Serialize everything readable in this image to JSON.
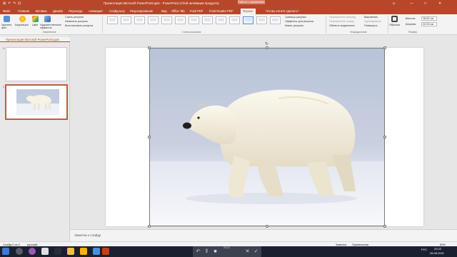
{
  "titlebar": {
    "quick_access": [
      "⊞",
      "↶",
      "↷",
      "⊡"
    ],
    "title": "Презентация Microsoft PowerPoint.pptx - PowerPoint (Сбой активации продукта)",
    "context_group": "Работа с рисунками",
    "user_icon": "user-icon",
    "controls": [
      "—",
      "□",
      "✕"
    ]
  },
  "tabs": [
    "Файл",
    "Главная",
    "Вставка",
    "Дизайн",
    "Переходы",
    "Анимация",
    "Слайд-шоу",
    "Рецензирование",
    "Вид",
    "Office Tab",
    "Foxit PDF",
    "Foxit Reader PDF",
    "Формат",
    "Что вы хотите сделать?"
  ],
  "active_tab": "Формат",
  "ribbon": {
    "adjust": {
      "remove_bg": "Удалить фон",
      "corrections": "Коррекция",
      "color": "Цвет",
      "artistic": "Художественные эффекты",
      "compress": "Сжать рисунки",
      "change": "Изменить рисунок",
      "reset": "Восстановить рисунок",
      "group": "Изменение"
    },
    "styles_group": "Стили рисунков",
    "style_options": {
      "border": "Граница рисунка",
      "effects": "Эффекты для рисунка",
      "layout": "Макет рисунка"
    },
    "arrange": {
      "forward": "Переместить вперед",
      "backward": "Переместить назад",
      "selection_pane": "Область выделения",
      "align": "Выровнять",
      "group": "Группировать",
      "rotate": "Повернуть",
      "group_label": "Упорядочение"
    },
    "size": {
      "crop": "Обрезка",
      "height_label": "Высота:",
      "height": "16,52 см",
      "width_label": "Ширина:",
      "width": "22,03 см",
      "group": "Размер"
    }
  },
  "file_tab": "Презентация Microsoft PowerPoint.pptx",
  "slides": [
    {
      "number": "1"
    },
    {
      "number": "2"
    }
  ],
  "notes_placeholder": "Заметки к слайду",
  "status": {
    "slide": "Слайд 2 из 2",
    "language": "русский",
    "notes": "Заметки",
    "comments": "Примечания",
    "zoom": "60%"
  },
  "media_popup": {
    "time": "00:02"
  },
  "taskbar": {
    "time": "20:22",
    "date": "26.06.2021",
    "lang": "РУС"
  }
}
